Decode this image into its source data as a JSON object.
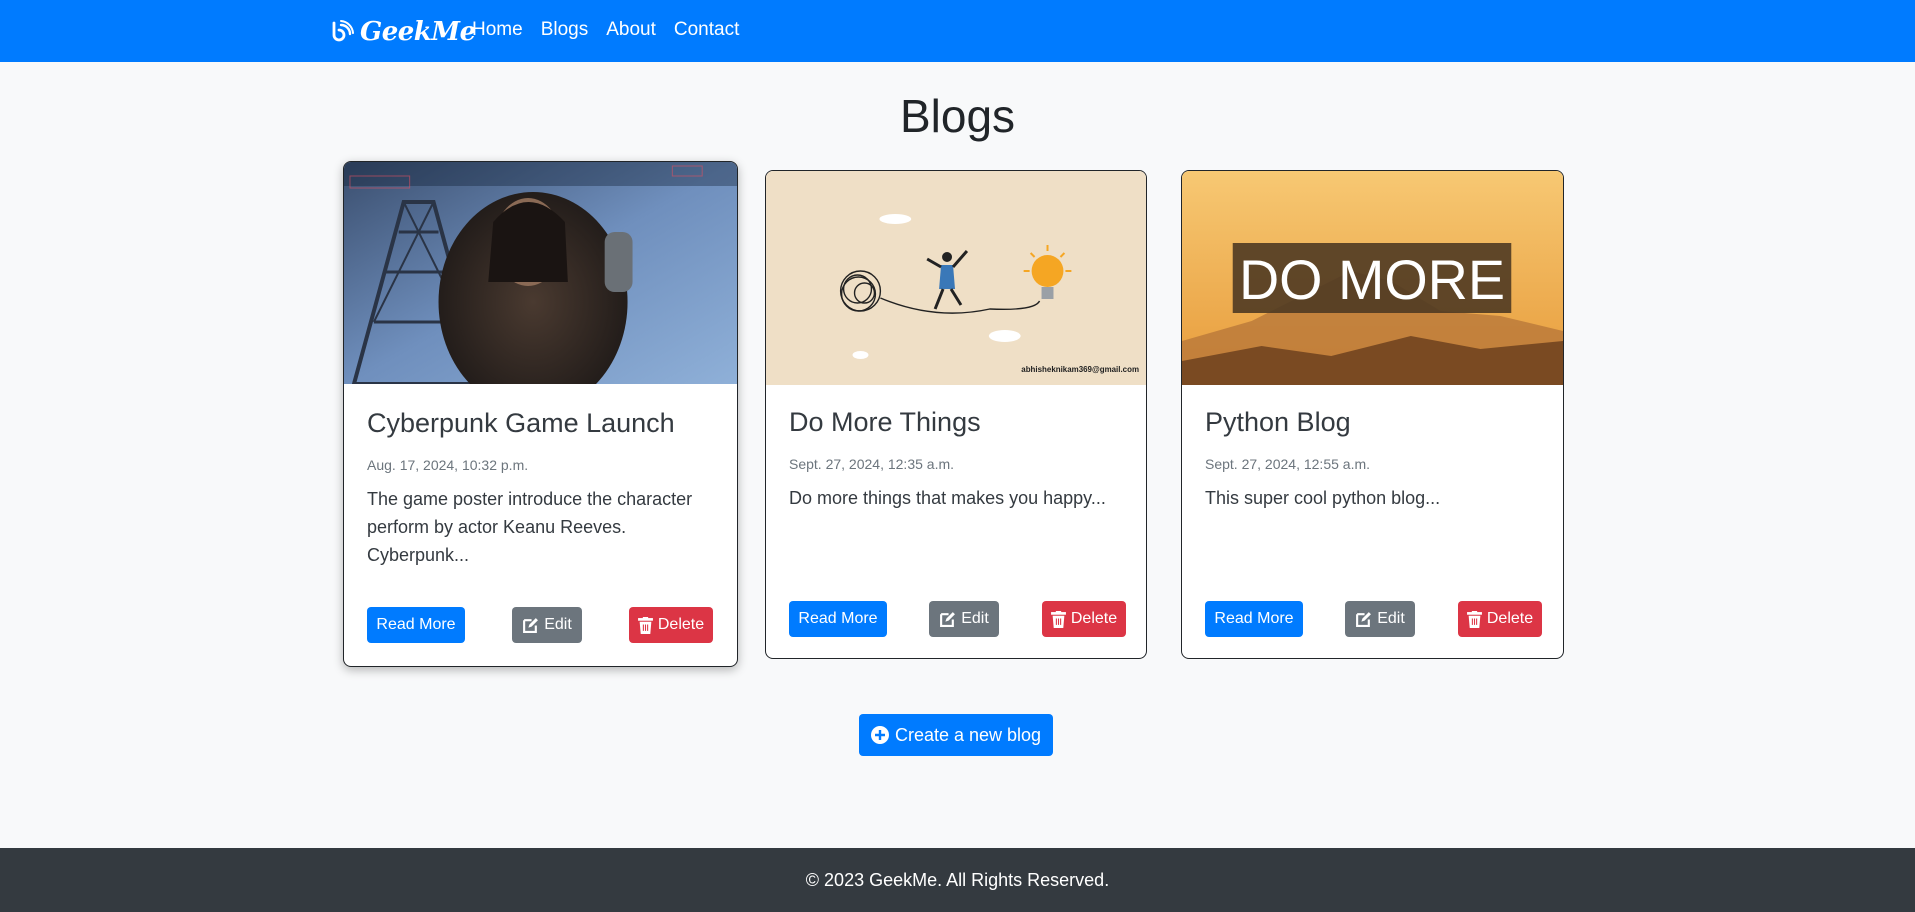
{
  "navbar": {
    "brand": "GeekMe",
    "links": [
      "Home",
      "Blogs",
      "About",
      "Contact"
    ]
  },
  "page": {
    "title": "Blogs"
  },
  "cards": [
    {
      "title": "Cyberpunk Game Launch",
      "date": "Aug. 17, 2024, 10:32 p.m.",
      "excerpt": "The game poster introduce the character perform by actor Keanu Reeves. Cyberpunk...",
      "read_more": "Read More",
      "edit": "Edit",
      "delete": "Delete"
    },
    {
      "title": "Do More Things",
      "date": "Sept. 27, 2024, 12:35 a.m.",
      "excerpt": "Do more things that makes you happy...",
      "read_more": "Read More",
      "edit": "Edit",
      "delete": "Delete",
      "image_email": "abhisheknikam369@gmail.com"
    },
    {
      "title": "Python Blog",
      "date": "Sept. 27, 2024, 12:55 a.m.",
      "excerpt": "This super cool python blog...",
      "read_more": "Read More",
      "edit": "Edit",
      "delete": "Delete",
      "image_text": "DO MORE"
    }
  ],
  "create_button": "Create a new blog",
  "footer": {
    "text": "© 2023 GeekMe. All Rights Reserved."
  },
  "colors": {
    "primary": "#007bff",
    "secondary": "#6c757d",
    "danger": "#dc3545",
    "footer_bg": "#343a40",
    "page_bg": "#f8f9fa"
  },
  "icons": {
    "brand": "blog-feed-icon",
    "edit": "edit-icon",
    "delete": "trash-icon",
    "create": "plus-circle-icon"
  }
}
